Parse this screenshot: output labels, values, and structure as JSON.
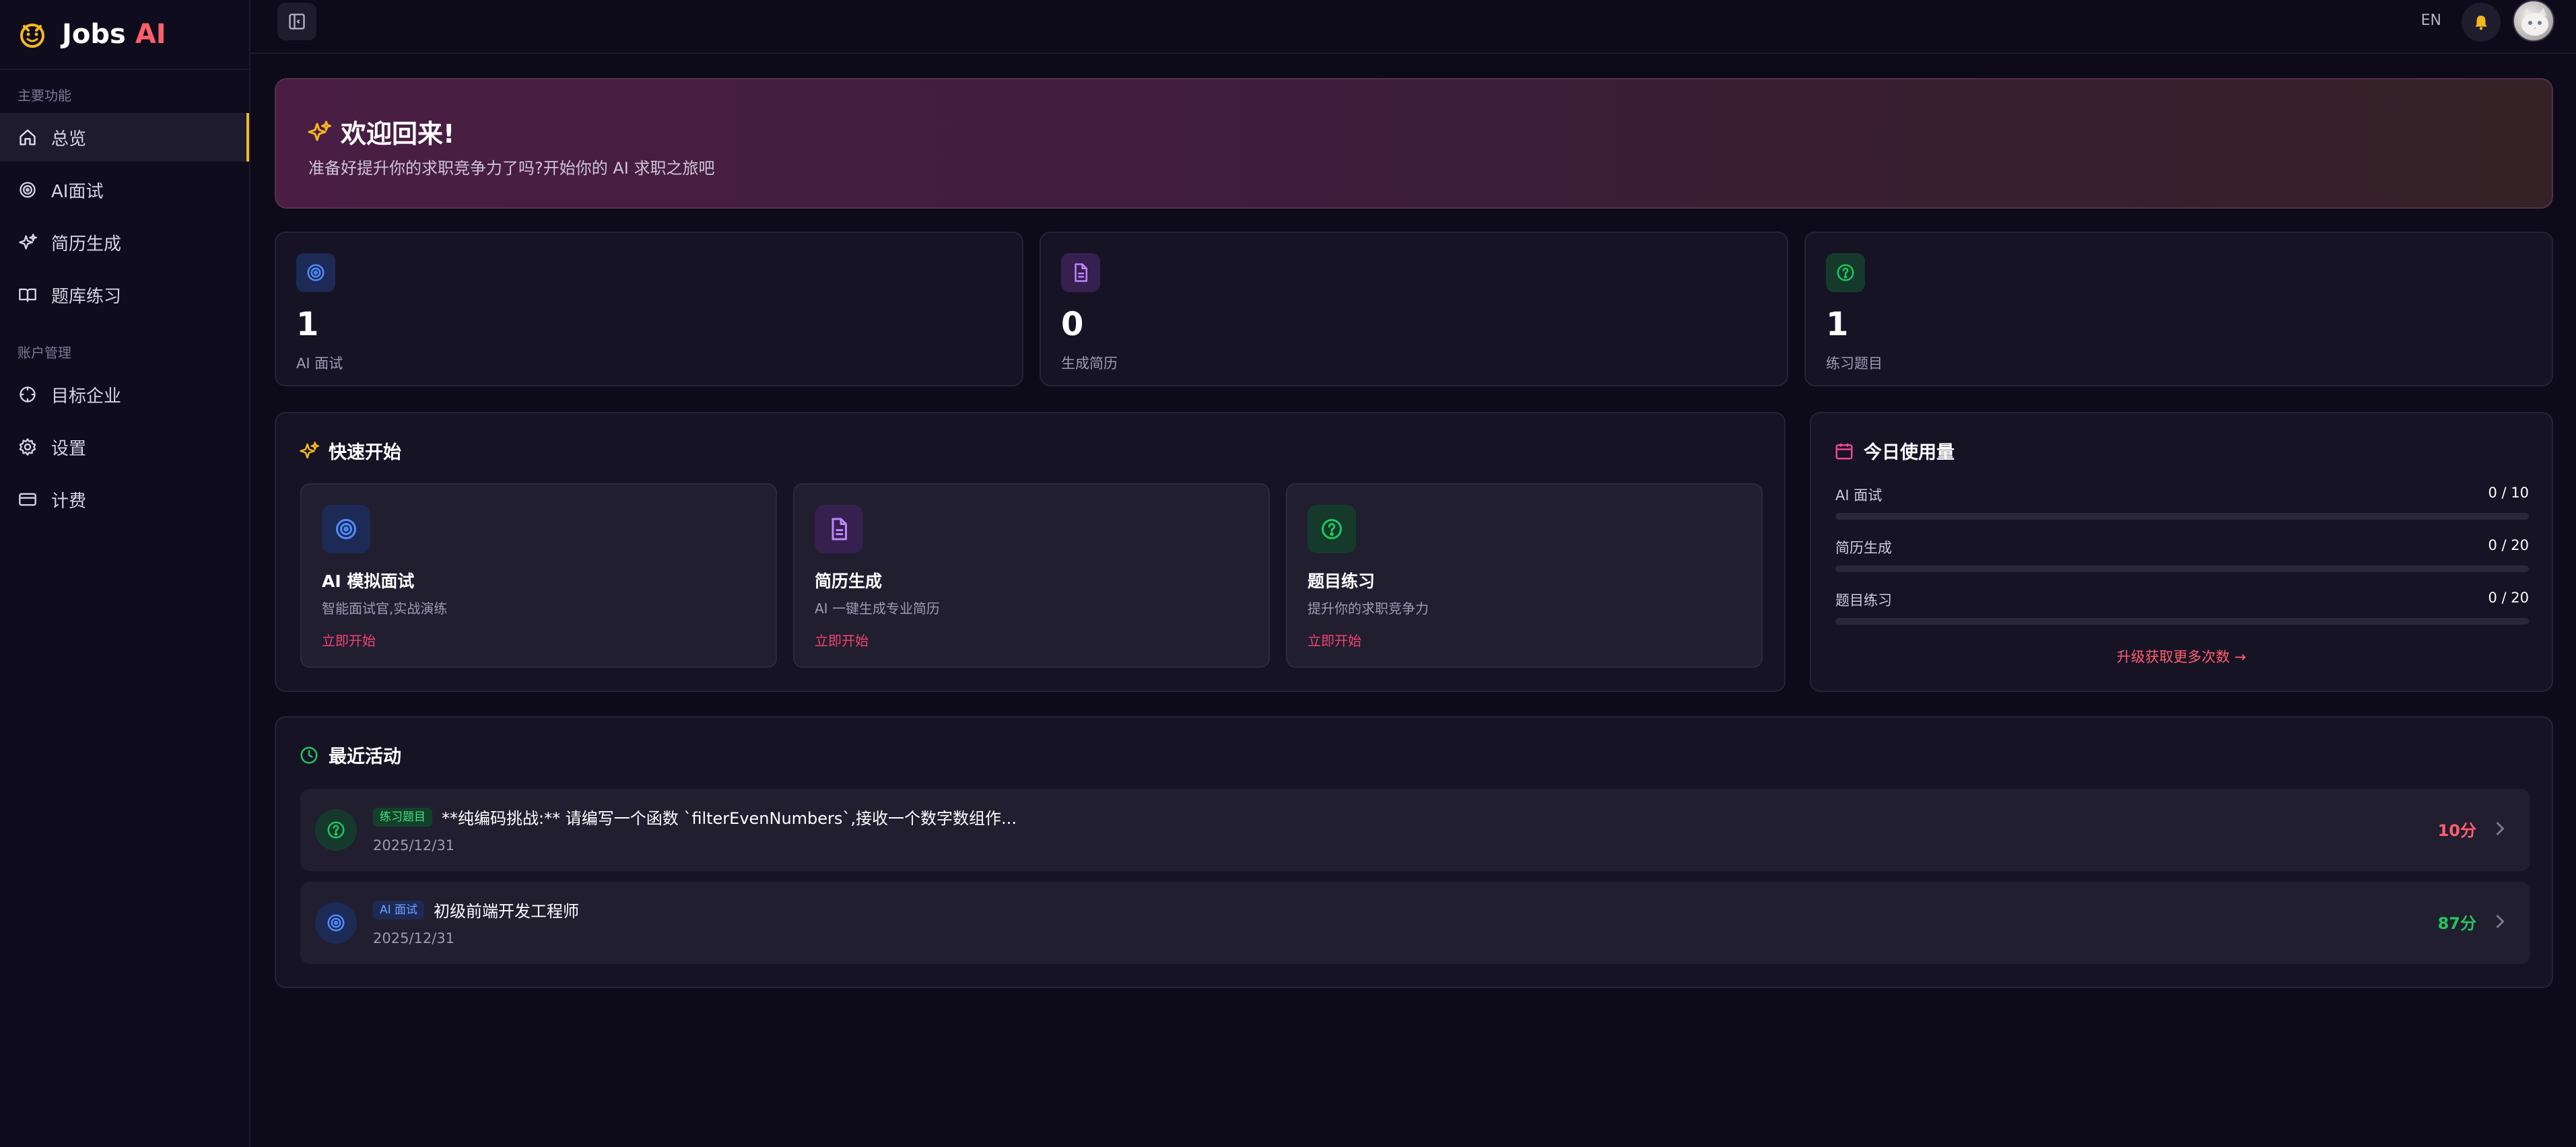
{
  "brand": {
    "name": "Jobs",
    "ai": "AI"
  },
  "sidebar": {
    "section_main": "主要功能",
    "section_account": "账户管理",
    "items": [
      {
        "label": "总览",
        "icon": "home-icon",
        "active": true
      },
      {
        "label": "AI面试",
        "icon": "target-icon",
        "active": false
      },
      {
        "label": "简历生成",
        "icon": "sparkles-icon",
        "active": false
      },
      {
        "label": "题库练习",
        "icon": "book-icon",
        "active": false
      },
      {
        "label": "目标企业",
        "icon": "crosshair-icon",
        "active": false
      },
      {
        "label": "设置",
        "icon": "gear-icon",
        "active": false
      },
      {
        "label": "计费",
        "icon": "credit-card-icon",
        "active": false
      }
    ]
  },
  "topbar": {
    "lang": "EN"
  },
  "banner": {
    "title": "欢迎回来!",
    "subtitle": "准备好提升你的求职竞争力了吗?开始你的 AI 求职之旅吧"
  },
  "stats": [
    {
      "value": "1",
      "label": "AI 面试",
      "icon": "target-icon",
      "color": "#3b82f6"
    },
    {
      "value": "0",
      "label": "生成简历",
      "icon": "document-icon",
      "color": "#a855f7"
    },
    {
      "value": "1",
      "label": "练习题目",
      "icon": "question-icon",
      "color": "#22c55e"
    }
  ],
  "quick_start": {
    "title": "快速开始",
    "cards": [
      {
        "title": "AI 模拟面试",
        "desc": "智能面试官,实战演练",
        "link": "立即开始",
        "icon": "target-icon",
        "color": "#3b82f6"
      },
      {
        "title": "简历生成",
        "desc": "AI 一键生成专业简历",
        "link": "立即开始",
        "icon": "document-icon",
        "color": "#a855f7"
      },
      {
        "title": "题目练习",
        "desc": "提升你的求职竞争力",
        "link": "立即开始",
        "icon": "question-icon",
        "color": "#22c55e"
      }
    ]
  },
  "usage": {
    "title": "今日使用量",
    "rows": [
      {
        "label": "AI 面试",
        "value": "0 / 10",
        "fraction": 0
      },
      {
        "label": "简历生成",
        "value": "0 / 20",
        "fraction": 0
      },
      {
        "label": "题目练习",
        "value": "0 / 20",
        "fraction": 0
      }
    ],
    "upgrade": "升级获取更多次数 →"
  },
  "activity": {
    "title": "最近活动",
    "items": [
      {
        "tag": "练习题目",
        "title": "**纯编码挑战:** 请编写一个函数 `filterEvenNumbers`,接收一个数字数组作...",
        "date": "2025/12/31",
        "score": "10分",
        "score_color": "#ff5f6d",
        "icon": "question-icon",
        "color": "#22c55e"
      },
      {
        "tag": "AI 面试",
        "title": "初级前端开发工程师",
        "date": "2025/12/31",
        "score": "87分",
        "score_color": "#22c55e",
        "icon": "target-icon",
        "color": "#3b82f6"
      }
    ]
  }
}
